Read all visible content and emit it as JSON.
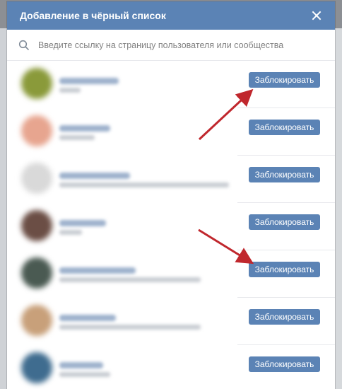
{
  "modal": {
    "title": "Добавление в чёрный список",
    "close_icon": "close-icon"
  },
  "search": {
    "placeholder": "Введите ссылку на страницу пользователя или сообщества",
    "icon": "search-icon"
  },
  "rows": [
    {
      "avatar_color": "#8a9a3a",
      "block_label": "Заблокировать"
    },
    {
      "avatar_color": "#e7a58f",
      "block_label": "Заблокировать"
    },
    {
      "avatar_color": "#d9d9d9",
      "block_label": "Заблокировать"
    },
    {
      "avatar_color": "#6b4e45",
      "block_label": "Заблокировать"
    },
    {
      "avatar_color": "#4a5a52",
      "block_label": "Заблокировать"
    },
    {
      "avatar_color": "#c8a07a",
      "block_label": "Заблокировать"
    },
    {
      "avatar_color": "#3f6c8f",
      "block_label": "Заблокировать"
    }
  ],
  "colors": {
    "header": "#5b83b5",
    "button": "#5b83b5",
    "arrow": "#c0272d"
  }
}
